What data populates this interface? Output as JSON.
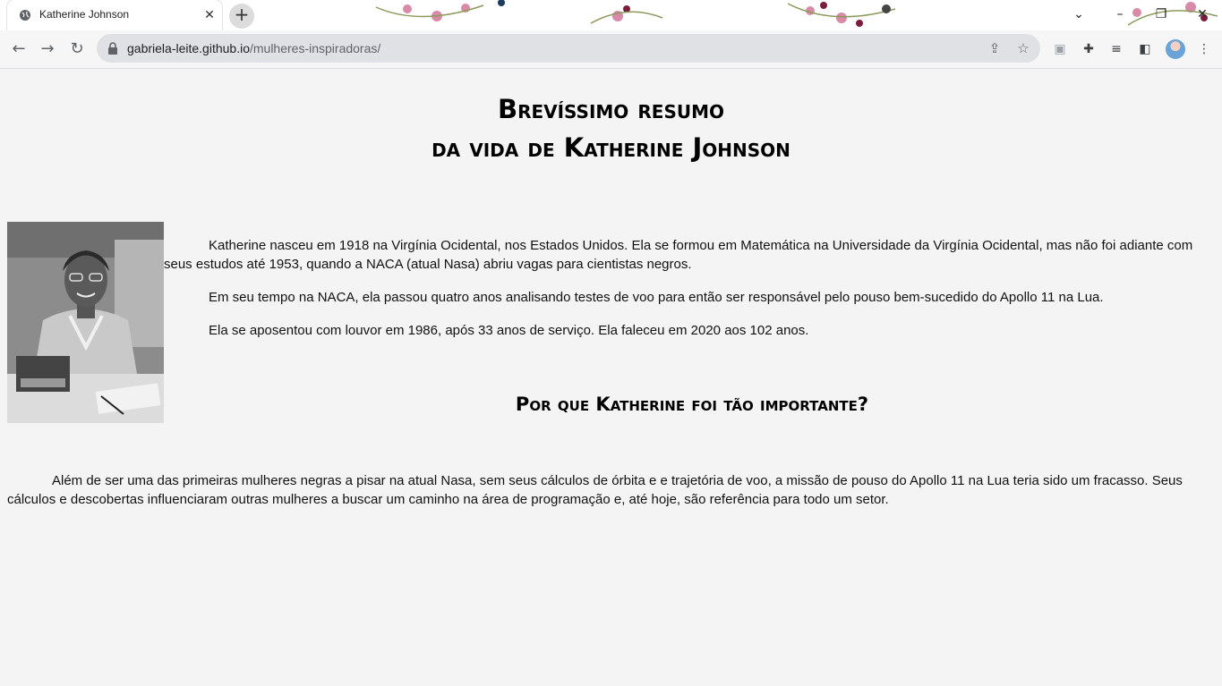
{
  "browser": {
    "tab_title": "Katherine Johnson",
    "url_host": "gabriela-leite.github.io",
    "url_path": "/mulheres-inspiradoras/"
  },
  "page": {
    "heading_line1": "Brevíssimo resumo",
    "heading_line2": "da vida de Katherine Johnson",
    "paragraphs": [
      "Katherine nasceu em 1918 na Virgínia Ocidental, nos Estados Unidos. Ela se formou em Matemática na Universidade da Virgínia Ocidental, mas não foi adiante com seus estudos até 1953, quando a NACA (atual Nasa) abriu vagas para cientistas negros.",
      "Em seu tempo na NACA, ela passou quatro anos analisando testes de voo para então ser responsável pelo pouso bem-sucedido do Apollo 11 na Lua.",
      "Ela se aposentou com louvor em 1986, após 33 anos de serviço. Ela faleceu em 2020 aos 102 anos."
    ],
    "subheading": "Por que Katherine foi tão importante?",
    "importance_paragraph": "Além de ser uma das primeiras mulheres negras a pisar na atual Nasa, sem seus cálculos de órbita e e trajetória de voo, a missão de pouso do Apollo 11 na Lua teria sido um fracasso. Seus cálculos e descobertas influenciaram outras mulheres a buscar um caminho na área de programação e, até hoje, são referência para todo um setor."
  }
}
